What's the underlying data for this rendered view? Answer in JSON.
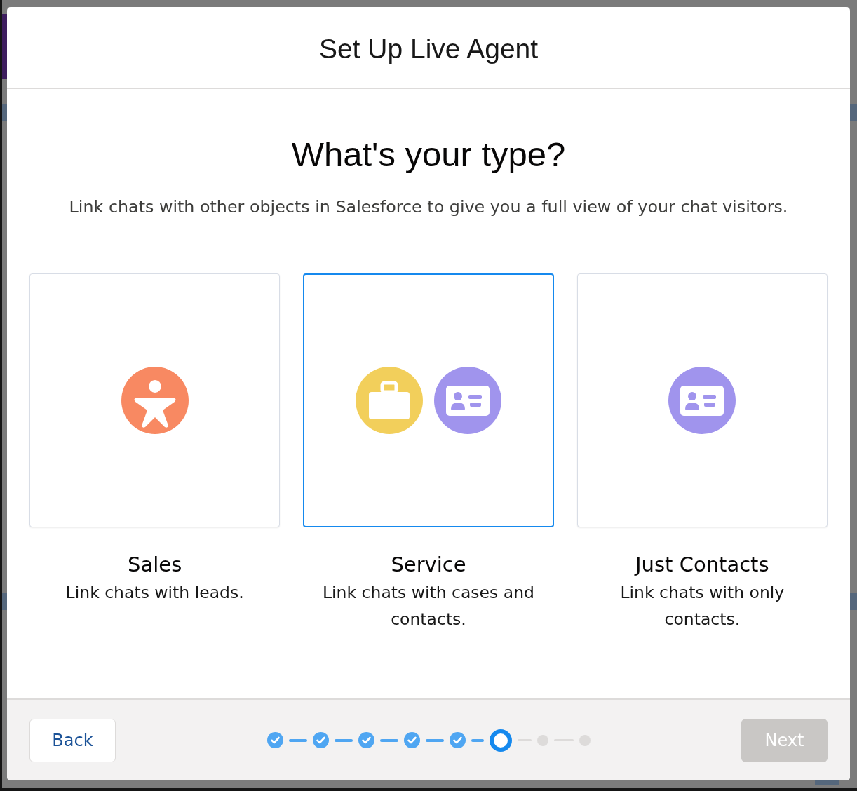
{
  "modal": {
    "title": "Set Up Live Agent"
  },
  "heading": "What's your type?",
  "description": "Link chats with other objects in Salesforce to give you a full view of your chat visitors.",
  "options": [
    {
      "title": "Sales",
      "description": "Link chats with leads.",
      "selected": false,
      "icons": [
        {
          "kind": "lead"
        }
      ]
    },
    {
      "title": "Service",
      "description": "Link chats with cases and contacts.",
      "selected": true,
      "icons": [
        {
          "kind": "case"
        },
        {
          "kind": "contact"
        }
      ]
    },
    {
      "title": "Just Contacts",
      "description": "Link chats with only contacts.",
      "selected": false,
      "icons": [
        {
          "kind": "contact"
        }
      ]
    }
  ],
  "footer": {
    "back_button": {
      "label": "Back",
      "disabled": false
    },
    "progress_steps": [
      {
        "completed": true,
        "selected": false
      },
      {
        "completed": true,
        "selected": false
      },
      {
        "completed": true,
        "selected": false
      },
      {
        "completed": true,
        "selected": false
      },
      {
        "completed": true,
        "selected": false
      },
      {
        "completed": false,
        "selected": true
      },
      {
        "completed": false,
        "selected": false
      },
      {
        "completed": false,
        "selected": false
      }
    ],
    "next_button": {
      "label": "Next",
      "disabled": true
    }
  }
}
